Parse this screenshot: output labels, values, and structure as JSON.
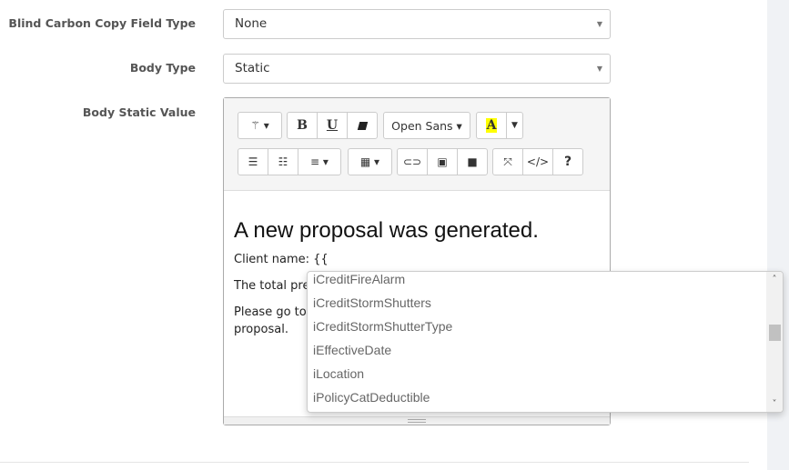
{
  "fields": [
    {
      "label": "Blind Carbon Copy Field Type",
      "value": "None"
    },
    {
      "label": "Body Type",
      "value": "Static"
    },
    {
      "label": "Body Static Value"
    }
  ],
  "toolbar": {
    "style_icon": "magic-wand-icon",
    "bold": "B",
    "underline": "U",
    "eraser_icon": "eraser-icon",
    "font": "Open Sans",
    "color_letter": "A",
    "highlight_color": "#ffff00",
    "code": "</>",
    "help": "?"
  },
  "editor": {
    "heading": "A new proposal was generated.",
    "line1": "Client name: {{",
    "line2": "The total pren",
    "line3a": "Please go to y",
    "line3b": "proposal."
  },
  "autocomplete": {
    "items": [
      "iCreditFireAlarm",
      "iCreditStormShutters",
      "iCreditStormShutterType",
      "iEffectiveDate",
      "iLocation",
      "iPolicyCatDeductible"
    ],
    "scroll_position": 0.4
  }
}
